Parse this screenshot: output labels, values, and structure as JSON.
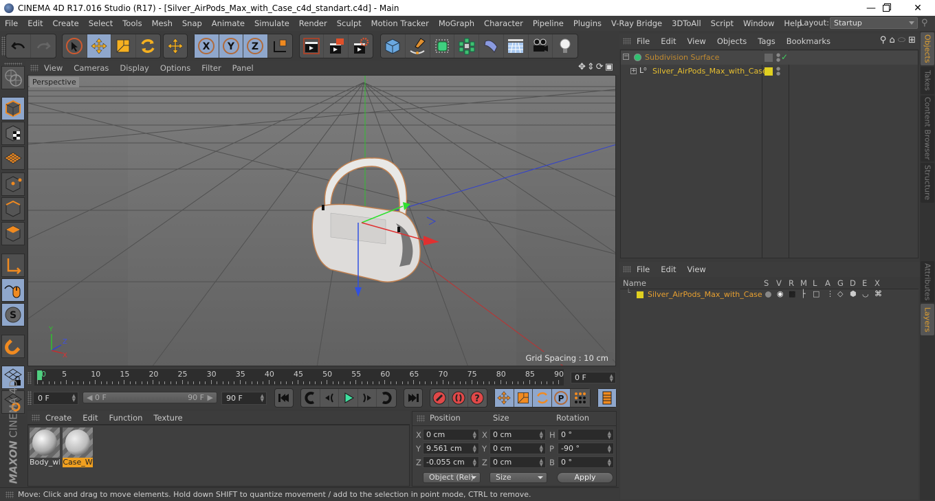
{
  "window": {
    "title": "CINEMA 4D R17.016 Studio (R17) - [Silver_AirPods_Max_with_Case_c4d_standart.c4d] - Main",
    "controls": [
      "minimize",
      "maximize",
      "close"
    ]
  },
  "menubar": {
    "items": [
      "File",
      "Edit",
      "Create",
      "Select",
      "Tools",
      "Mesh",
      "Snap",
      "Animate",
      "Simulate",
      "Render",
      "Sculpt",
      "Motion Tracker",
      "MoGraph",
      "Character",
      "Pipeline",
      "Plugins",
      "V-Ray Bridge",
      "3DToAll",
      "Script",
      "Window",
      "Help"
    ],
    "layout_label": "Layout:",
    "layout_value": "Startup"
  },
  "toolbar": {
    "tools": [
      "undo",
      "redo",
      "live-selection",
      "move",
      "scale",
      "rotate",
      "recent-tool",
      "x-axis-lock",
      "y-axis-lock",
      "z-axis-lock",
      "coordinate-system",
      "render-view",
      "render-to-picture-viewer",
      "render-settings",
      "cube",
      "pen",
      "subdivision-surface",
      "cloner",
      "bend-deformer",
      "floor",
      "camera",
      "light"
    ],
    "active": [
      "move",
      "x-axis-lock",
      "y-axis-lock",
      "z-axis-lock"
    ]
  },
  "left_tools": [
    "make-editable",
    "model-mode",
    "texture-mode",
    "workplane-mode",
    "points-mode",
    "edges-mode",
    "polygons-mode",
    "axis-mode",
    "tweak-mode",
    "soft-selection",
    "snapping",
    "workplane-lock",
    "workplane-snap"
  ],
  "viewport": {
    "menu": [
      "View",
      "Cameras",
      "Display",
      "Options",
      "Filter",
      "Panel"
    ],
    "camera_label": "Perspective",
    "grid_spacing": "Grid Spacing : 10 cm",
    "axis_labels": {
      "x": "X",
      "y": "Y",
      "z": "Z"
    },
    "colors": {
      "x": "#d03030",
      "y": "#30c030",
      "z": "#3040d0"
    }
  },
  "timeline": {
    "ticks": [
      "0",
      "5",
      "10",
      "15",
      "20",
      "25",
      "30",
      "35",
      "40",
      "45",
      "50",
      "55",
      "60",
      "65",
      "70",
      "75",
      "80",
      "85",
      "90"
    ],
    "current_frame": "0 F",
    "start_field": "0 F",
    "range_start": "0 F",
    "range_end": "90 F",
    "end_field": "90 F",
    "playhead_color": "#50d080"
  },
  "transport": {
    "buttons": [
      "go-to-start",
      "previous-key",
      "previous-frame",
      "play",
      "next-frame",
      "next-key",
      "go-to-end",
      "record",
      "autokey",
      "keyframe-selection",
      "position-key",
      "scale-key",
      "rotation-key",
      "parameter-key",
      "point-level-key",
      "timeline-window"
    ]
  },
  "materials": {
    "menu": [
      "Create",
      "Edit",
      "Function",
      "Texture"
    ],
    "items": [
      {
        "label": "Body_wl",
        "selected": false
      },
      {
        "label": "Case_W",
        "selected": true
      }
    ]
  },
  "coordinates": {
    "headers": [
      "Position",
      "Size",
      "Rotation"
    ],
    "position": [
      {
        "axis": "X",
        "value": "0 cm"
      },
      {
        "axis": "Y",
        "value": "9.561 cm"
      },
      {
        "axis": "Z",
        "value": "-0.055 cm"
      }
    ],
    "size": [
      {
        "axis": "X",
        "value": "0 cm"
      },
      {
        "axis": "Y",
        "value": "0 cm"
      },
      {
        "axis": "Z",
        "value": "0 cm"
      }
    ],
    "rotation": [
      {
        "axis": "H",
        "value": "0 °"
      },
      {
        "axis": "P",
        "value": "-90 °"
      },
      {
        "axis": "B",
        "value": "0 °"
      }
    ],
    "mode_dropdown": "Object (Rel)",
    "size_dropdown": "Size",
    "apply_label": "Apply"
  },
  "status": {
    "text": "Move: Click and drag to move elements. Hold down SHIFT to quantize movement / add to the selection in point mode, CTRL to remove."
  },
  "object_manager": {
    "menu": [
      "File",
      "Edit",
      "View",
      "Objects",
      "Tags",
      "Bookmarks"
    ],
    "objects": [
      {
        "name": "Subdivision Surface",
        "color": "#c08a30",
        "tag": "checkmark"
      },
      {
        "name": "Silver_AirPods_Max_with_Case",
        "color": "#e8c030",
        "layer_color": "#e0d020"
      }
    ]
  },
  "layer_manager": {
    "menu": [
      "File",
      "Edit",
      "View"
    ],
    "columns": [
      "Name",
      "S",
      "V",
      "R",
      "M",
      "L",
      "A",
      "G",
      "D",
      "E",
      "X"
    ],
    "layers": [
      {
        "name": "Silver_AirPods_Max_with_Case",
        "color": "#e0d020"
      }
    ]
  },
  "right_tabs": {
    "top": [
      {
        "label": "Objects",
        "active": true
      },
      {
        "label": "Takes",
        "active": false
      },
      {
        "label": "Content Browser",
        "active": false
      },
      {
        "label": "Structure",
        "active": false
      }
    ],
    "bottom": [
      {
        "label": "Attributes",
        "active": false
      },
      {
        "label": "Layers",
        "active": true
      }
    ]
  },
  "branding": {
    "maxon": "MAXON",
    "product": "CINEMA 4D"
  }
}
